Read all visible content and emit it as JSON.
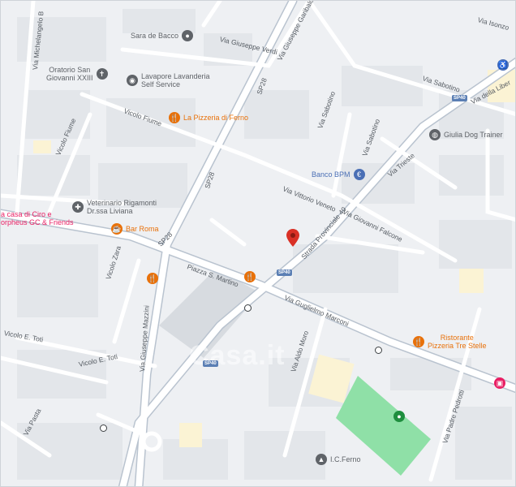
{
  "map": {
    "watermark": "Casa.it",
    "streets": [
      {
        "id": "via-michelangelo",
        "text": "Via Michelangelo B"
      },
      {
        "id": "via-giuseppe-verdi",
        "text": "Via Giuseppe Verdi"
      },
      {
        "id": "via-giuseppe-garibaldi",
        "text": "Via Giuseppe Garibaldi"
      },
      {
        "id": "via-isonzo",
        "text": "Via Isonzo"
      },
      {
        "id": "sp28-north",
        "text": "SP28"
      },
      {
        "id": "sp28-mid",
        "text": "SP28"
      },
      {
        "id": "sp28-south",
        "text": "SP28"
      },
      {
        "id": "via-sabotino-top",
        "text": "Via Sabotino"
      },
      {
        "id": "via-della-liberta",
        "text": "Via della Liber"
      },
      {
        "id": "vicolo-fiume-upper",
        "text": "Vicolo Fiume"
      },
      {
        "id": "vicolo-fiume-left",
        "text": "Vicolo Fiume"
      },
      {
        "id": "via-sabotino-1",
        "text": "Via Sabotino"
      },
      {
        "id": "via-sabotino-2",
        "text": "Via Sabotino"
      },
      {
        "id": "via-trieste",
        "text": "Via Trieste"
      },
      {
        "id": "via-vittorio-veneto",
        "text": "Via Vittorio Veneto"
      },
      {
        "id": "strada-provinciale-40",
        "text": "Strada Provinciale 40"
      },
      {
        "id": "via-giovanni-falcone",
        "text": "Via Giovanni Falcone"
      },
      {
        "id": "vicolo-zara",
        "text": "Vicolo Zara"
      },
      {
        "id": "piazza-s-martino",
        "text": "Piazza S. Martino"
      },
      {
        "id": "via-guglielmo-marconi",
        "text": "Via Guglielmo Marconi"
      },
      {
        "id": "via-aldo-moro",
        "text": "Via Aldo Moro"
      },
      {
        "id": "via-giuseppe-mazzini",
        "text": "Via Giuseppe Mazzini"
      },
      {
        "id": "vicolo-e-toti-upper",
        "text": "Vicolo E. Toti"
      },
      {
        "id": "vicolo-e-toti-lower",
        "text": "Vicolo E. Toti"
      },
      {
        "id": "via-padre-pedrotti",
        "text": "Via Padre Pedrotti"
      },
      {
        "id": "via-pasta",
        "text": "Via Pasta"
      }
    ],
    "shields": [
      {
        "id": "sp40-east",
        "text": "SP40"
      },
      {
        "id": "sp40-center",
        "text": "SP40"
      },
      {
        "id": "sp40-south",
        "text": "SP40"
      }
    ],
    "pois": [
      {
        "id": "sara-de-bacco",
        "text": "Sara de Bacco",
        "icon": "pin-icon",
        "color": "#5f6368"
      },
      {
        "id": "oratorio",
        "text": "Oratorio San\nGiovanni XXIII",
        "icon": "church-icon",
        "color": "#5f6368"
      },
      {
        "id": "lavanderia",
        "text": "Lavapore Lavanderia\nSelf Service",
        "icon": "laundry-icon",
        "color": "#5f6368"
      },
      {
        "id": "pizzeria-di-ferno",
        "text": "La Pizzeria di Ferno",
        "icon": "restaurant-icon",
        "color": "#e8710a"
      },
      {
        "id": "giulia-dog-trainer",
        "text": "Giulia Dog Trainer",
        "icon": "paw-icon",
        "color": "#5f6368"
      },
      {
        "id": "banco-bpm",
        "text": "Banco BPM",
        "icon": "bank-icon",
        "color": "#4a6fb5"
      },
      {
        "id": "veterinario",
        "text": "Veterinario Rigamonti\nDr.ssa Liviana",
        "icon": "vet-icon",
        "color": "#5f6368"
      },
      {
        "id": "casa-di-ciro",
        "text": "a casa di Ciro e\norpheus GC & Friends",
        "icon": "shop-icon",
        "color": "#e91e63"
      },
      {
        "id": "bar-roma",
        "text": "Bar Roma",
        "icon": "cafe-icon",
        "color": "#e8710a"
      },
      {
        "id": "ristorante-tre-stelle",
        "text": "Ristorante\nPizzeria Tre Stelle",
        "icon": "restaurant-icon",
        "color": "#e8710a"
      },
      {
        "id": "ic-ferno",
        "text": "I.C.Ferno",
        "icon": "school-icon",
        "color": "#5f6368"
      }
    ]
  }
}
